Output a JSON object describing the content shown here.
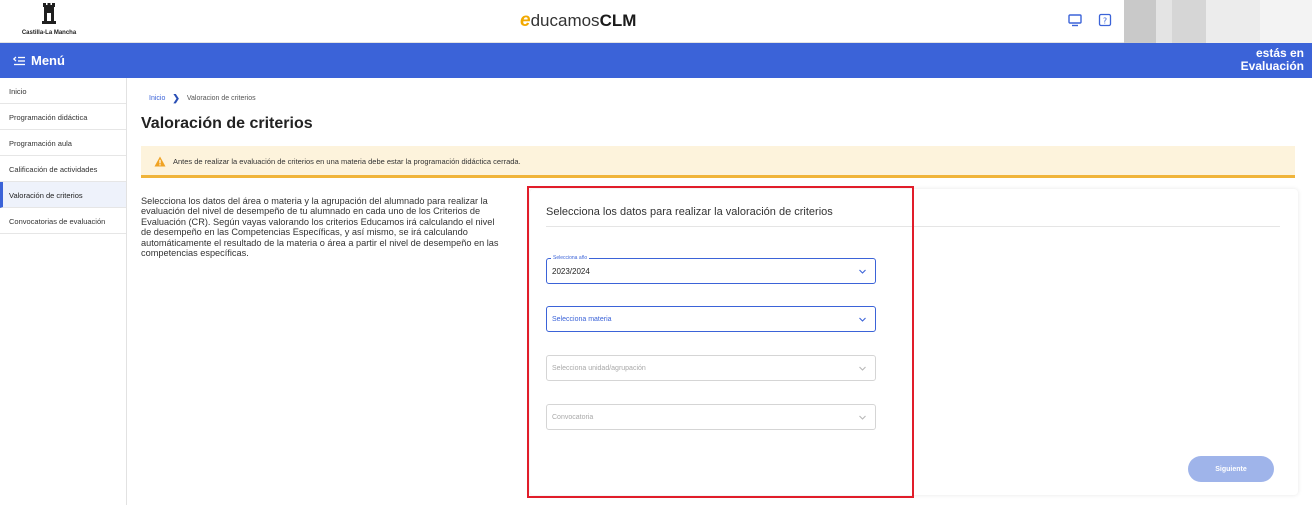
{
  "header": {
    "region_logo_text": "Castilla-La Mancha",
    "brand_prefix": "e",
    "brand_main": "ducamos",
    "brand_suffix": "CLM"
  },
  "menubar": {
    "menu_label": "Menú",
    "context_line1": "estás en",
    "context_line2": "Evaluación"
  },
  "sidebar": {
    "items": [
      {
        "label": "Inicio"
      },
      {
        "label": "Programación didáctica"
      },
      {
        "label": "Programación aula"
      },
      {
        "label": "Calificación de actividades"
      },
      {
        "label": "Valoración de criterios"
      },
      {
        "label": "Convocatorias de evaluación"
      }
    ]
  },
  "breadcrumb": {
    "home": "Inicio",
    "current": "Valoracion de criterios"
  },
  "page": {
    "title": "Valoración de criterios",
    "warning": "Antes de realizar la evaluación de criterios en una materia debe estar la programación didáctica cerrada.",
    "intro": "Selecciona los datos del área o materia y la agrupación del alumnado para realizar la evaluación del nivel de desempeño de tu alumnado en cada uno de los Criterios de Evaluación (CR). Según vayas valorando los criterios Educamos irá calculando el nivel de desempeño en las Competencias Específicas, y así mismo, se irá calculando automáticamente el resultado de la materia o área a partir el nivel de desempeño en las competencias específicas."
  },
  "form": {
    "title": "Selecciona los datos para realizar la valoración de criterios",
    "year_legend": "Selecciona año",
    "year_value": "2023/2024",
    "subject_placeholder": "Selecciona materia",
    "unit_placeholder": "Selecciona unidad/agrupación",
    "call_placeholder": "Convocatoria",
    "next_label": "Siguiente"
  },
  "colors": {
    "primary": "#3b63d8",
    "warning_bg": "#fdf3dc",
    "warning_border": "#f0b43a",
    "highlight": "#e11d2a"
  }
}
